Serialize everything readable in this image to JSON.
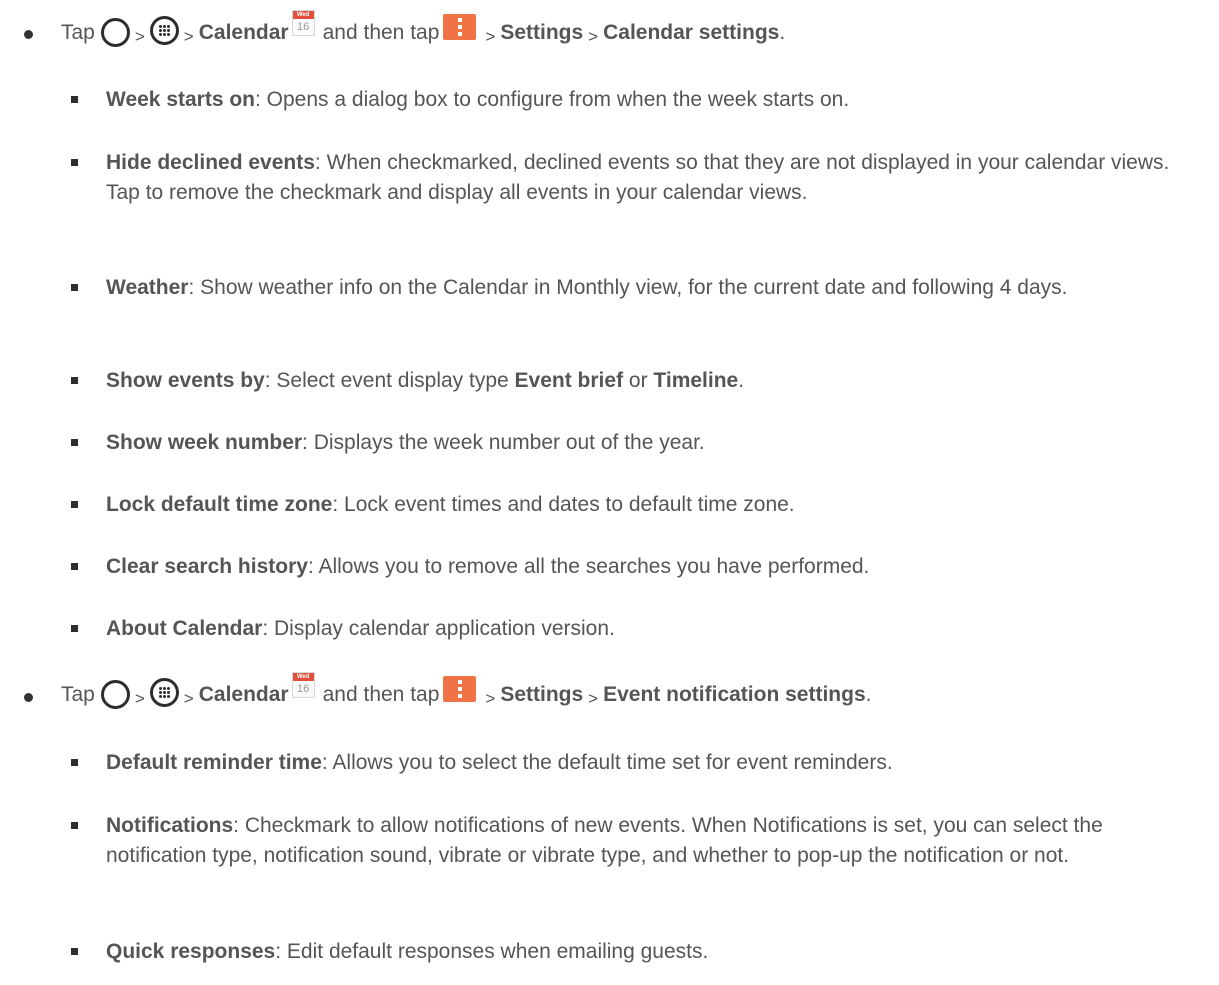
{
  "sections": [
    {
      "tap": "Tap",
      "gt": ">",
      "calendar": "Calendar",
      "cal_weekday": "Wed",
      "cal_day": "16",
      "and_then_tap": "and then tap",
      "settings": "Settings",
      "target": "Calendar settings",
      "period": ".",
      "items": [
        {
          "term": "Week starts on",
          "desc": ": Opens a dialog box to configure from when the week starts on."
        },
        {
          "term": "Hide declined events",
          "desc": ": When checkmarked, declined events so that they are not displayed in your calendar views. Tap to remove the checkmark and display all events in your calendar views."
        },
        {
          "term": "Weather",
          "desc": ": Show weather info on the Calendar in Monthly view, for the current date and following 4 days."
        },
        {
          "term": "Show events by",
          "desc_a": ": Select event display type ",
          "bold_a": "Event brief",
          "desc_b": " or ",
          "bold_b": "Timeline",
          "desc_c": "."
        },
        {
          "term": "Show week number",
          "desc": ": Displays the week number out of the year."
        },
        {
          "term": "Lock default time zone",
          "desc": ": Lock event times and dates to default time zone."
        },
        {
          "term": "Clear search history",
          "desc": ": Allows you to remove all the searches you have performed."
        },
        {
          "term": "About Calendar",
          "desc": ": Display calendar application version."
        }
      ]
    },
    {
      "tap": "Tap",
      "gt": ">",
      "calendar": "Calendar",
      "cal_weekday": "Wed",
      "cal_day": "16",
      "and_then_tap": "and then tap",
      "settings": "Settings",
      "target": "Event notification settings",
      "period": ".",
      "items": [
        {
          "term": "Default reminder time",
          "desc": ": Allows you to select the default time set for event reminders."
        },
        {
          "term": "Notifications",
          "desc": ": Checkmark to allow notifications of new events. When Notifications is set, you can select the notification type, notification sound, vibrate or vibrate type, and whether to pop-up the notification or not."
        },
        {
          "term": "Quick responses",
          "desc": ": Edit default responses when emailing guests."
        }
      ]
    }
  ]
}
